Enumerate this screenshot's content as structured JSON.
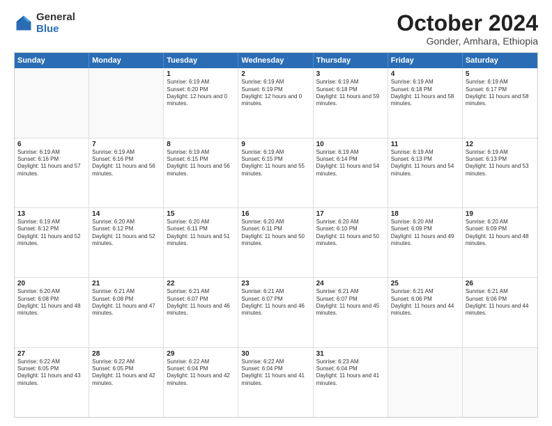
{
  "header": {
    "logo_general": "General",
    "logo_blue": "Blue",
    "title": "October 2024",
    "subtitle": "Gonder, Amhara, Ethiopia"
  },
  "days": [
    "Sunday",
    "Monday",
    "Tuesday",
    "Wednesday",
    "Thursday",
    "Friday",
    "Saturday"
  ],
  "weeks": [
    [
      {
        "day": "",
        "empty": true
      },
      {
        "day": "",
        "empty": true
      },
      {
        "day": "1",
        "sunrise": "Sunrise: 6:19 AM",
        "sunset": "Sunset: 6:20 PM",
        "daylight": "Daylight: 12 hours and 0 minutes."
      },
      {
        "day": "2",
        "sunrise": "Sunrise: 6:19 AM",
        "sunset": "Sunset: 6:19 PM",
        "daylight": "Daylight: 12 hours and 0 minutes."
      },
      {
        "day": "3",
        "sunrise": "Sunrise: 6:19 AM",
        "sunset": "Sunset: 6:18 PM",
        "daylight": "Daylight: 11 hours and 59 minutes."
      },
      {
        "day": "4",
        "sunrise": "Sunrise: 6:19 AM",
        "sunset": "Sunset: 6:18 PM",
        "daylight": "Daylight: 11 hours and 58 minutes."
      },
      {
        "day": "5",
        "sunrise": "Sunrise: 6:19 AM",
        "sunset": "Sunset: 6:17 PM",
        "daylight": "Daylight: 11 hours and 58 minutes."
      }
    ],
    [
      {
        "day": "6",
        "sunrise": "Sunrise: 6:19 AM",
        "sunset": "Sunset: 6:16 PM",
        "daylight": "Daylight: 11 hours and 57 minutes."
      },
      {
        "day": "7",
        "sunrise": "Sunrise: 6:19 AM",
        "sunset": "Sunset: 6:16 PM",
        "daylight": "Daylight: 11 hours and 56 minutes."
      },
      {
        "day": "8",
        "sunrise": "Sunrise: 6:19 AM",
        "sunset": "Sunset: 6:15 PM",
        "daylight": "Daylight: 11 hours and 56 minutes."
      },
      {
        "day": "9",
        "sunrise": "Sunrise: 6:19 AM",
        "sunset": "Sunset: 6:15 PM",
        "daylight": "Daylight: 11 hours and 55 minutes."
      },
      {
        "day": "10",
        "sunrise": "Sunrise: 6:19 AM",
        "sunset": "Sunset: 6:14 PM",
        "daylight": "Daylight: 11 hours and 54 minutes."
      },
      {
        "day": "11",
        "sunrise": "Sunrise: 6:19 AM",
        "sunset": "Sunset: 6:13 PM",
        "daylight": "Daylight: 11 hours and 54 minutes."
      },
      {
        "day": "12",
        "sunrise": "Sunrise: 6:19 AM",
        "sunset": "Sunset: 6:13 PM",
        "daylight": "Daylight: 11 hours and 53 minutes."
      }
    ],
    [
      {
        "day": "13",
        "sunrise": "Sunrise: 6:19 AM",
        "sunset": "Sunset: 6:12 PM",
        "daylight": "Daylight: 11 hours and 52 minutes."
      },
      {
        "day": "14",
        "sunrise": "Sunrise: 6:20 AM",
        "sunset": "Sunset: 6:12 PM",
        "daylight": "Daylight: 11 hours and 52 minutes."
      },
      {
        "day": "15",
        "sunrise": "Sunrise: 6:20 AM",
        "sunset": "Sunset: 6:11 PM",
        "daylight": "Daylight: 11 hours and 51 minutes."
      },
      {
        "day": "16",
        "sunrise": "Sunrise: 6:20 AM",
        "sunset": "Sunset: 6:11 PM",
        "daylight": "Daylight: 11 hours and 50 minutes."
      },
      {
        "day": "17",
        "sunrise": "Sunrise: 6:20 AM",
        "sunset": "Sunset: 6:10 PM",
        "daylight": "Daylight: 11 hours and 50 minutes."
      },
      {
        "day": "18",
        "sunrise": "Sunrise: 6:20 AM",
        "sunset": "Sunset: 6:09 PM",
        "daylight": "Daylight: 11 hours and 49 minutes."
      },
      {
        "day": "19",
        "sunrise": "Sunrise: 6:20 AM",
        "sunset": "Sunset: 6:09 PM",
        "daylight": "Daylight: 11 hours and 48 minutes."
      }
    ],
    [
      {
        "day": "20",
        "sunrise": "Sunrise: 6:20 AM",
        "sunset": "Sunset: 6:08 PM",
        "daylight": "Daylight: 11 hours and 48 minutes."
      },
      {
        "day": "21",
        "sunrise": "Sunrise: 6:21 AM",
        "sunset": "Sunset: 6:08 PM",
        "daylight": "Daylight: 11 hours and 47 minutes."
      },
      {
        "day": "22",
        "sunrise": "Sunrise: 6:21 AM",
        "sunset": "Sunset: 6:07 PM",
        "daylight": "Daylight: 11 hours and 46 minutes."
      },
      {
        "day": "23",
        "sunrise": "Sunrise: 6:21 AM",
        "sunset": "Sunset: 6:07 PM",
        "daylight": "Daylight: 11 hours and 46 minutes."
      },
      {
        "day": "24",
        "sunrise": "Sunrise: 6:21 AM",
        "sunset": "Sunset: 6:07 PM",
        "daylight": "Daylight: 11 hours and 45 minutes."
      },
      {
        "day": "25",
        "sunrise": "Sunrise: 6:21 AM",
        "sunset": "Sunset: 6:06 PM",
        "daylight": "Daylight: 11 hours and 44 minutes."
      },
      {
        "day": "26",
        "sunrise": "Sunrise: 6:21 AM",
        "sunset": "Sunset: 6:06 PM",
        "daylight": "Daylight: 11 hours and 44 minutes."
      }
    ],
    [
      {
        "day": "27",
        "sunrise": "Sunrise: 6:22 AM",
        "sunset": "Sunset: 6:05 PM",
        "daylight": "Daylight: 11 hours and 43 minutes."
      },
      {
        "day": "28",
        "sunrise": "Sunrise: 6:22 AM",
        "sunset": "Sunset: 6:05 PM",
        "daylight": "Daylight: 11 hours and 42 minutes."
      },
      {
        "day": "29",
        "sunrise": "Sunrise: 6:22 AM",
        "sunset": "Sunset: 6:04 PM",
        "daylight": "Daylight: 11 hours and 42 minutes."
      },
      {
        "day": "30",
        "sunrise": "Sunrise: 6:22 AM",
        "sunset": "Sunset: 6:04 PM",
        "daylight": "Daylight: 11 hours and 41 minutes."
      },
      {
        "day": "31",
        "sunrise": "Sunrise: 6:23 AM",
        "sunset": "Sunset: 6:04 PM",
        "daylight": "Daylight: 11 hours and 41 minutes."
      },
      {
        "day": "",
        "empty": true
      },
      {
        "day": "",
        "empty": true
      }
    ]
  ]
}
